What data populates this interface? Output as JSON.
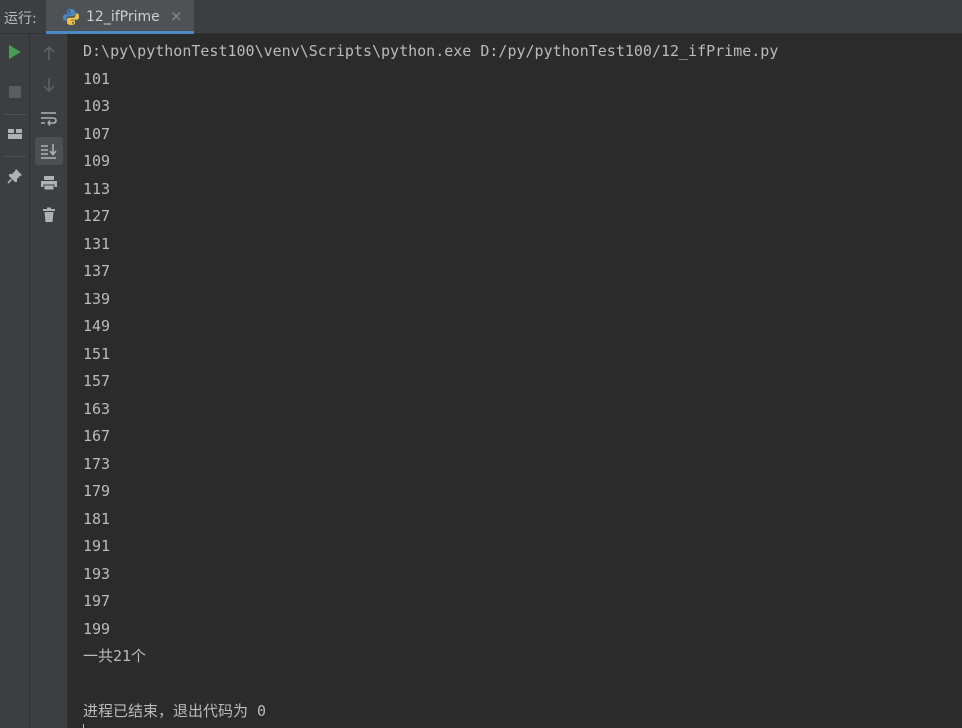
{
  "run_label": "运行:",
  "tab": {
    "title": "12_ifPrime",
    "close": "×",
    "icon": "python-icon"
  },
  "left_toolbar": [
    {
      "icon": "play-icon",
      "color": "#499c54"
    },
    {
      "icon": "stop-icon"
    },
    {
      "icon": "layout-icon"
    },
    {
      "icon": "pin-icon"
    }
  ],
  "console_toolbar": [
    {
      "icon": "arrow-up-icon"
    },
    {
      "icon": "arrow-down-icon"
    },
    {
      "icon": "soft-wrap-icon"
    },
    {
      "icon": "scroll-to-end-icon",
      "selected": true
    },
    {
      "icon": "print-icon"
    },
    {
      "icon": "trash-icon"
    }
  ],
  "console": {
    "command": "D:\\py\\pythonTest100\\venv\\Scripts\\python.exe D:/py/pythonTest100/12_ifPrime.py",
    "primes": [
      "101",
      "103",
      "107",
      "109",
      "113",
      "127",
      "131",
      "137",
      "139",
      "149",
      "151",
      "157",
      "163",
      "167",
      "173",
      "179",
      "181",
      "191",
      "193",
      "197",
      "199"
    ],
    "summary": "一共21个",
    "blank": "",
    "exit_message": "进程已结束，退出代码为 0"
  }
}
